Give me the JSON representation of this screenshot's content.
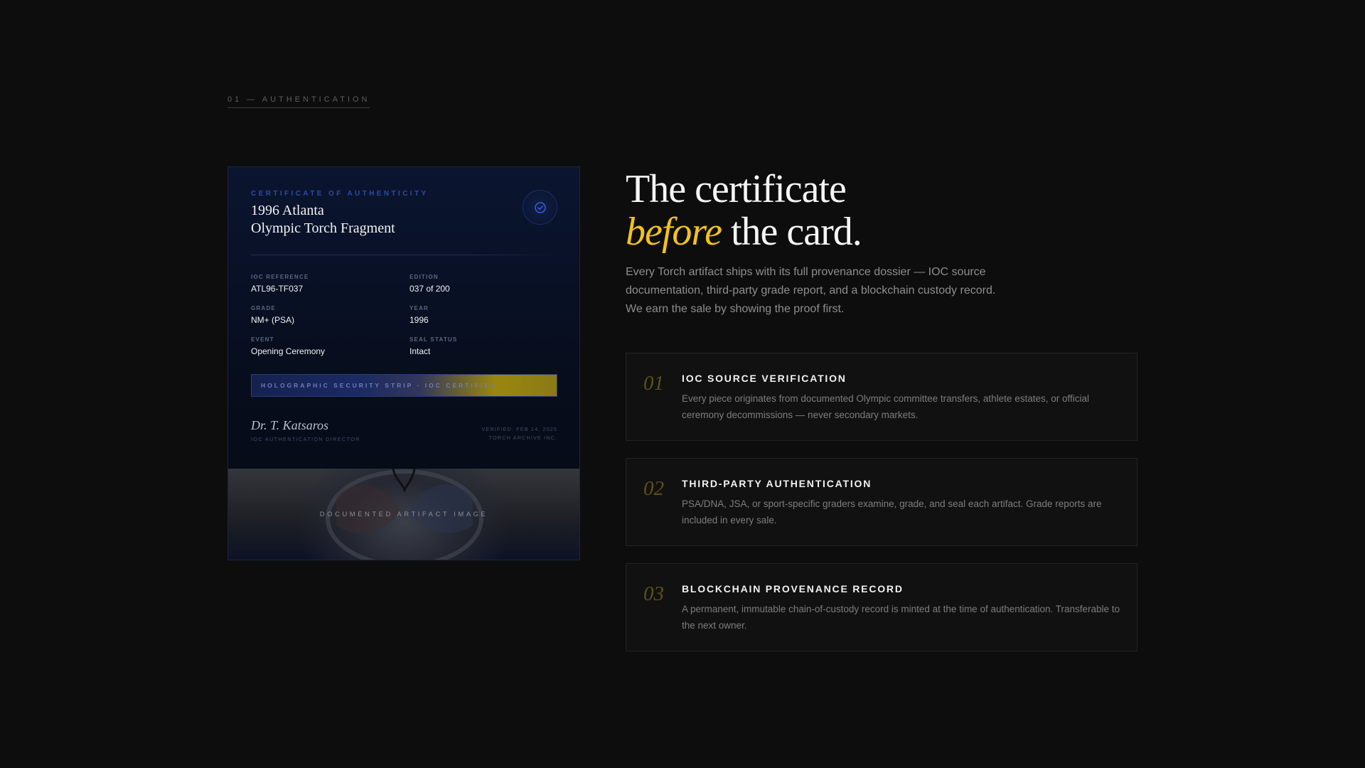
{
  "section": {
    "eyebrow": "01 — AUTHENTICATION"
  },
  "certificate": {
    "kicker": "CERTIFICATE OF AUTHENTICITY",
    "title_line1": "1996 Atlanta",
    "title_line2": "Olympic Torch Fragment",
    "seal_icon": "check-circle-icon",
    "fields": [
      {
        "label": "IOC REFERENCE",
        "value": "ATL96-TF037"
      },
      {
        "label": "EDITION",
        "value": "037 of 200"
      },
      {
        "label": "GRADE",
        "value": "NM+ (PSA)"
      },
      {
        "label": "YEAR",
        "value": "1996"
      },
      {
        "label": "EVENT",
        "value": "Opening Ceremony"
      },
      {
        "label": "SEAL STATUS",
        "value": "Intact"
      }
    ],
    "holo_strip": "HOLOGRAPHIC SECURITY STRIP · IOC CERTIFIED",
    "signature": "Dr. T. Katsaros",
    "signer_role": "IOC AUTHENTICATION DIRECTOR",
    "verified": "VERIFIED: FEB 14, 2025",
    "archive": "TORCH ARCHIVE INC.",
    "artifact_caption": "DOCUMENTED ARTIFACT IMAGE",
    "colors": {
      "accent_blue": "#2f4aa8",
      "gold": "#9a870f"
    }
  },
  "hero": {
    "headline_line1": "The certificate",
    "headline_accent": "before",
    "headline_rest": " the card.",
    "lede": "Every Torch artifact ships with its full provenance dossier — IOC source documentation, third-party grade report, and a blockchain custody record. We earn the sale by showing the proof first.",
    "accent_color": "#f2c21b"
  },
  "features": [
    {
      "num": "01",
      "title": "IOC SOURCE VERIFICATION",
      "desc": "Every piece originates from documented Olympic committee transfers, athlete estates, or official ceremony decommissions — never secondary markets."
    },
    {
      "num": "02",
      "title": "THIRD-PARTY AUTHENTICATION",
      "desc": "PSA/DNA, JSA, or sport-specific graders examine, grade, and seal each artifact. Grade reports are included in every sale."
    },
    {
      "num": "03",
      "title": "BLOCKCHAIN PROVENANCE RECORD",
      "desc": "A permanent, immutable chain-of-custody record is minted at the time of authentication. Transferable to the next owner."
    }
  ]
}
